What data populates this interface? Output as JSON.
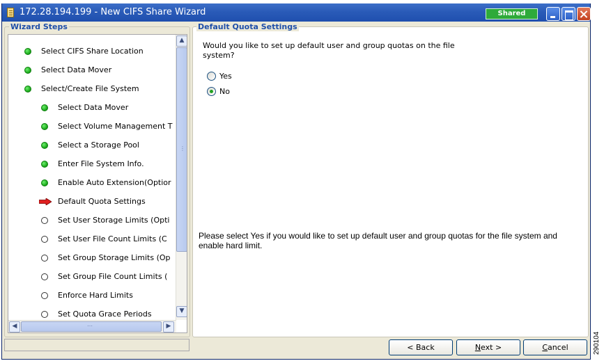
{
  "window": {
    "title": "172.28.194.199 - New CIFS Share Wizard",
    "badge": "Shared",
    "colors": {
      "titlebar": "#2a5bb8",
      "badge": "#2eaa3a",
      "done": "#17a417",
      "current": "#e02020"
    }
  },
  "wizard_steps": {
    "heading": "Wizard Steps",
    "items": [
      {
        "label": "Select CIFS Share Location",
        "status": "done",
        "indent": 0
      },
      {
        "label": "Select Data Mover",
        "status": "done",
        "indent": 0
      },
      {
        "label": "Select/Create File System",
        "status": "done",
        "indent": 0
      },
      {
        "label": "Select Data Mover",
        "status": "done",
        "indent": 1
      },
      {
        "label": "Select Volume Management T",
        "status": "done",
        "indent": 1
      },
      {
        "label": "Select a Storage Pool",
        "status": "done",
        "indent": 1
      },
      {
        "label": "Enter File System Info.",
        "status": "done",
        "indent": 1
      },
      {
        "label": "Enable Auto Extension(Optior",
        "status": "done",
        "indent": 1
      },
      {
        "label": "Default Quota Settings",
        "status": "current",
        "indent": 1
      },
      {
        "label": "Set User Storage Limits (Opti",
        "status": "pending",
        "indent": 1
      },
      {
        "label": "Set User File Count Limits  (C",
        "status": "pending",
        "indent": 1
      },
      {
        "label": "Set Group Storage Limits (Op",
        "status": "pending",
        "indent": 1
      },
      {
        "label": "Set Group File Count Limits (",
        "status": "pending",
        "indent": 1
      },
      {
        "label": "Enforce Hard Limits",
        "status": "pending",
        "indent": 1
      },
      {
        "label": "Set Quota Grace Periods",
        "status": "pending",
        "indent": 1
      }
    ]
  },
  "panel": {
    "heading": "Default Quota Settings",
    "question": "Would you like to set up default user and group quotas on the file system?",
    "options": [
      {
        "label": "Yes",
        "selected": false
      },
      {
        "label": "No",
        "selected": true
      }
    ],
    "help": "Please select Yes if you would like to set up default user and group quotas for the file system and enable hard limit."
  },
  "buttons": {
    "back": {
      "label": "< Back",
      "mnemonic": ""
    },
    "next": {
      "mnemonic": "N",
      "rest": "ext >"
    },
    "cancel": {
      "mnemonic": "C",
      "rest": "ancel"
    }
  },
  "figure_id": "290104"
}
